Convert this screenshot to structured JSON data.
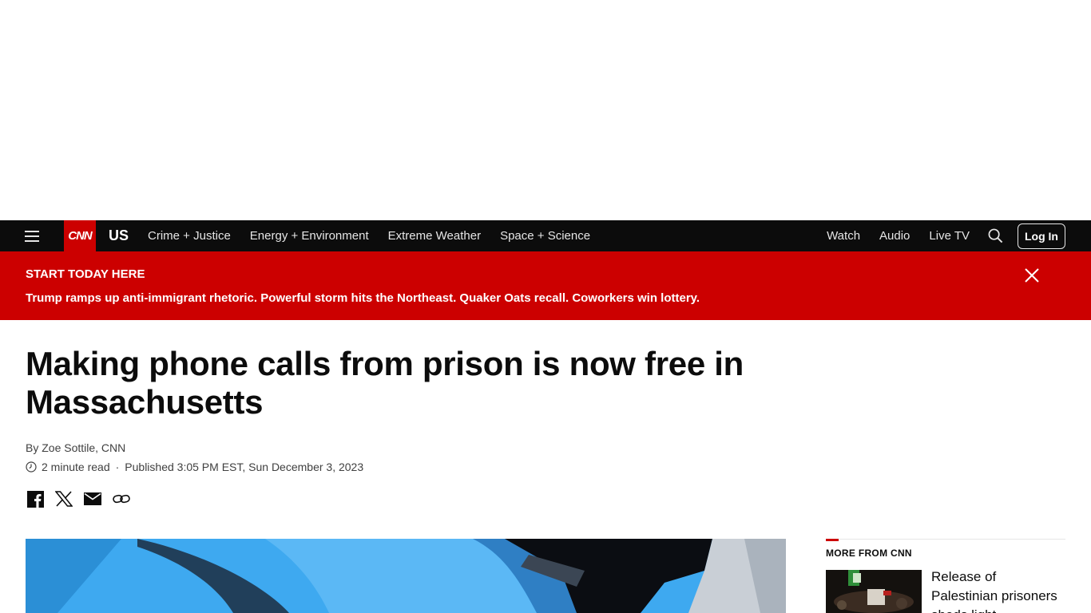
{
  "nav": {
    "logo_text": "CNN",
    "section": "US",
    "links": [
      "Crime + Justice",
      "Energy + Environment",
      "Extreme Weather",
      "Space + Science"
    ],
    "right_links": [
      "Watch",
      "Audio",
      "Live TV"
    ],
    "login_label": "Log In"
  },
  "banner": {
    "title": "START TODAY HERE",
    "text": "Trump ramps up anti-immigrant rhetoric. Powerful storm hits the Northeast. Quaker Oats recall. Coworkers win lottery."
  },
  "article": {
    "headline": "Making phone calls from prison is now free in Massachusetts",
    "byline": "By Zoe Sottile, CNN",
    "read_time": "2 minute read",
    "separator": "·",
    "published": "Published 3:05 PM EST, Sun December 3, 2023"
  },
  "sidebar": {
    "title": "MORE FROM CNN",
    "items": [
      {
        "text": "Release of Palestinian prisoners sheds light"
      }
    ]
  },
  "colors": {
    "brand_red": "#cc0000",
    "nav_bg": "#0c0c0c"
  }
}
